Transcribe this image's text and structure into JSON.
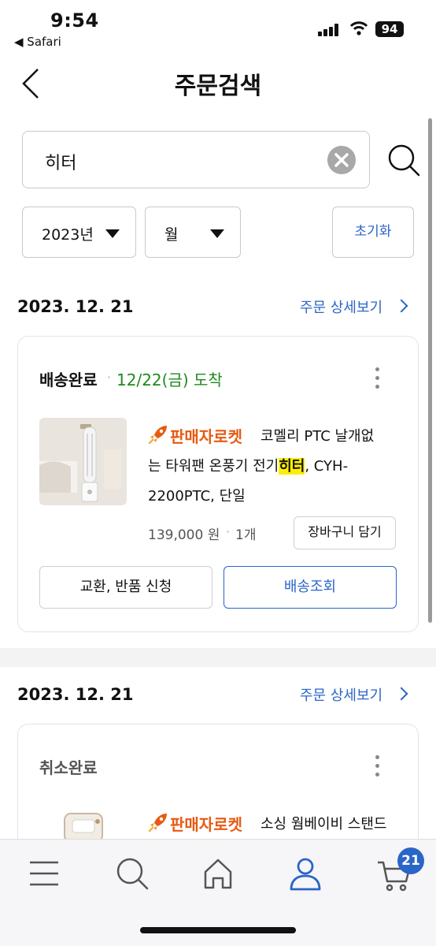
{
  "status_bar": {
    "time": "9:54",
    "back_app": "◀ Safari",
    "battery": "94"
  },
  "header": {
    "title": "주문검색"
  },
  "search": {
    "value": "히터"
  },
  "filters": {
    "year": "2023년",
    "month": "월",
    "reset": "초기화"
  },
  "orders": [
    {
      "date": "2023. 12. 21",
      "detail_link": "주문 상세보기",
      "status": "배송완료",
      "arrival": "12/22(금) 도착",
      "badge": "판매자로켓",
      "product_line1": "코멜리 PTC 날개없",
      "product_line2_pre": "는 타워팬 온풍기 전기",
      "product_highlight": "히터",
      "product_line2_post": ", CYH-",
      "product_line3": "2200PTC, 단일",
      "price": "139,000 원",
      "quantity": "1개",
      "cart_button": "장바구니 담기",
      "exchange_button": "교환, 반품 신청",
      "tracking_button": "배송조회"
    },
    {
      "date": "2023. 12. 21",
      "detail_link": "주문 상세보기",
      "status": "취소완료",
      "badge": "판매자로켓",
      "product_line1": "소싱 웜베이비 스탠드"
    }
  ],
  "bottom_nav": {
    "cart_count": "21",
    "items": [
      "menu-icon",
      "search-icon",
      "home-icon",
      "user-icon",
      "cart-icon"
    ]
  },
  "colors": {
    "accent": "#2a65c8",
    "arrival_green": "#1e8a1e",
    "rocket_orange": "#e85a12",
    "highlight": "#ffee00"
  }
}
